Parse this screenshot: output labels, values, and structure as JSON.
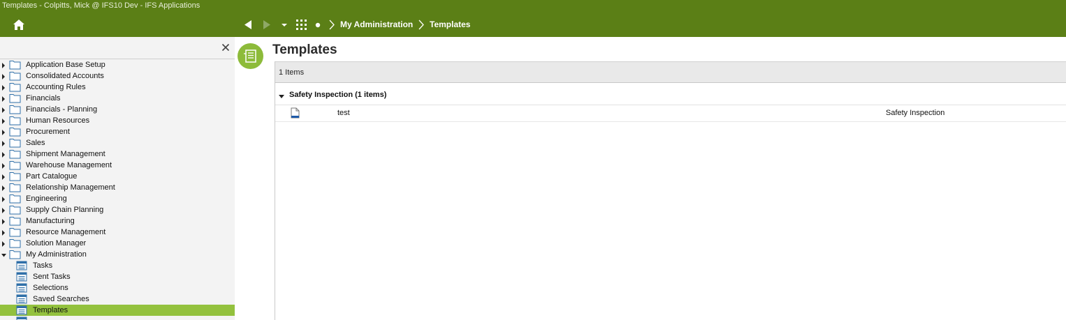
{
  "window": {
    "title": "Templates - Colpitts, Mick @ IFS10 Dev - IFS Applications"
  },
  "nav": {
    "home_icon": "home-icon",
    "back_icon": "triangle-left-icon",
    "forward_icon": "triangle-right-icon",
    "dropdown_icon": "caret-down-icon",
    "apps_icon": "grid-icon",
    "dot_icon": "dot-icon",
    "breadcrumb": [
      "My Administration",
      "Templates"
    ]
  },
  "sidebar": {
    "close_icon": "close-icon",
    "items": [
      {
        "label": "Application Base Setup",
        "expanded": false
      },
      {
        "label": "Consolidated Accounts",
        "expanded": false
      },
      {
        "label": "Accounting Rules",
        "expanded": false
      },
      {
        "label": "Financials",
        "expanded": false
      },
      {
        "label": "Financials - Planning",
        "expanded": false
      },
      {
        "label": "Human Resources",
        "expanded": false
      },
      {
        "label": "Procurement",
        "expanded": false
      },
      {
        "label": "Sales",
        "expanded": false
      },
      {
        "label": "Shipment Management",
        "expanded": false
      },
      {
        "label": "Warehouse Management",
        "expanded": false
      },
      {
        "label": "Part Catalogue",
        "expanded": false
      },
      {
        "label": "Relationship Management",
        "expanded": false
      },
      {
        "label": "Engineering",
        "expanded": false
      },
      {
        "label": "Supply Chain Planning",
        "expanded": false
      },
      {
        "label": "Manufacturing",
        "expanded": false
      },
      {
        "label": "Resource Management",
        "expanded": false
      },
      {
        "label": "Solution Manager",
        "expanded": false
      },
      {
        "label": "My Administration",
        "expanded": true
      }
    ],
    "children": [
      {
        "label": "Tasks",
        "selected": false
      },
      {
        "label": "Sent Tasks",
        "selected": false
      },
      {
        "label": "Selections",
        "selected": false
      },
      {
        "label": "Saved Searches",
        "selected": false
      },
      {
        "label": "Templates",
        "selected": true
      },
      {
        "label": "",
        "selected": false
      }
    ],
    "selected_color": "#93c13e"
  },
  "main": {
    "title": "Templates",
    "count_label": "1 Items",
    "group": {
      "label": "Safety Inspection (1 items)",
      "expanded": true
    },
    "rows": [
      {
        "name": "test",
        "type": "Safety Inspection",
        "icon": "document-icon"
      }
    ]
  },
  "colors": {
    "header_green": "#5b7f16",
    "accent_green": "#8dbb3a"
  }
}
